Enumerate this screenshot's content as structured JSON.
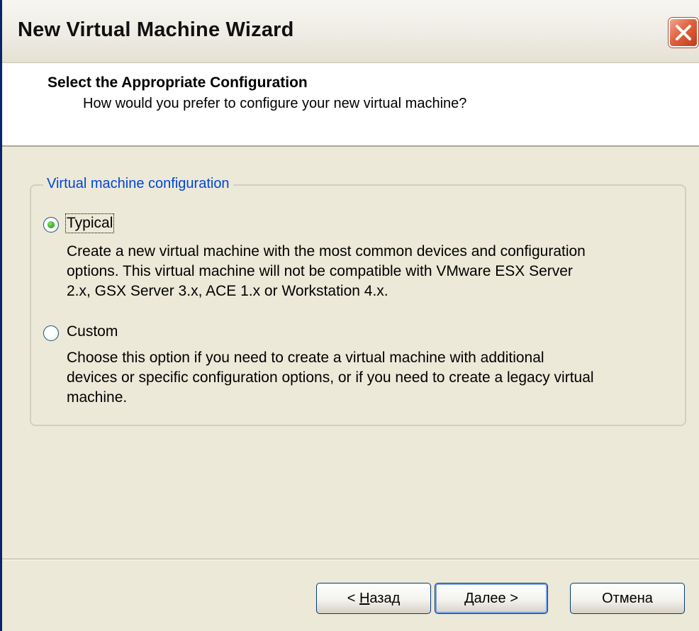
{
  "window": {
    "title": "New Virtual Machine Wizard",
    "close_icon": "close-x-icon"
  },
  "header": {
    "title": "Select the Appropriate Configuration",
    "subtitle": "How would you prefer to configure your new virtual machine?"
  },
  "group": {
    "legend": "Virtual machine configuration",
    "options": [
      {
        "label": "Typical",
        "selected": true,
        "description_lines": [
          "Create a new virtual machine with the most common devices and configuration",
          "options. This virtual machine will not be compatible with VMware ESX Server",
          "2.x, GSX Server 3.x, ACE 1.x or Workstation 4.x."
        ]
      },
      {
        "label": "Custom",
        "selected": false,
        "description_lines": [
          "Choose this option if you need to create a virtual machine with additional",
          "devices or specific configuration options, or if you need to create a legacy virtual",
          "machine."
        ]
      }
    ]
  },
  "buttons": {
    "back": {
      "prefix": "< ",
      "mnemonic": "Н",
      "rest": "азад"
    },
    "next": {
      "mnemonic": "Д",
      "rest": "алее >"
    },
    "cancel": {
      "label": "Отмена"
    }
  },
  "colors": {
    "legend_text": "#0046d5",
    "dialog_bg": "#ece9d8",
    "close_button": "#e0633f",
    "radio_dot": "#3fb524"
  }
}
